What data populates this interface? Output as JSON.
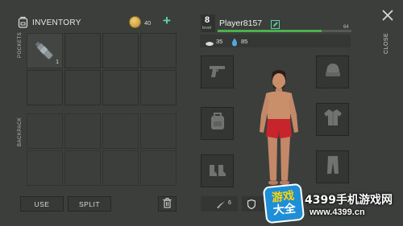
{
  "header": {
    "title": "INVENTORY",
    "coins": "40",
    "add_symbol": "+"
  },
  "inventory": {
    "pockets_label": "POCKETS",
    "backpack_label": "BACKPACK",
    "pocket_items": [
      {
        "icon": "water-bottle-icon",
        "count": "1"
      }
    ]
  },
  "actions": {
    "use_label": "USE",
    "split_label": "SPLIT"
  },
  "player": {
    "level": "8",
    "level_label": "level",
    "name": "Player8157",
    "xp_value": "64",
    "xp_progress": 0.78,
    "hunger": "35",
    "thirst": "85"
  },
  "equipment": {
    "slots": [
      "pistol-icon",
      "beanie-icon",
      "backpack-icon",
      "jacket-icon",
      "boots-icon",
      "pants-icon"
    ]
  },
  "stats": {
    "damage": "6"
  },
  "close_label": "CLOSE",
  "watermark": {
    "logo_top": "游戏",
    "logo_bottom": "大全",
    "site_name": "4399手机游戏网",
    "site_url": "www.4399.cn"
  },
  "colors": {
    "background": "#3b3e3b",
    "xp_bar": "#4caf50",
    "accent": "#5fd1b0"
  }
}
